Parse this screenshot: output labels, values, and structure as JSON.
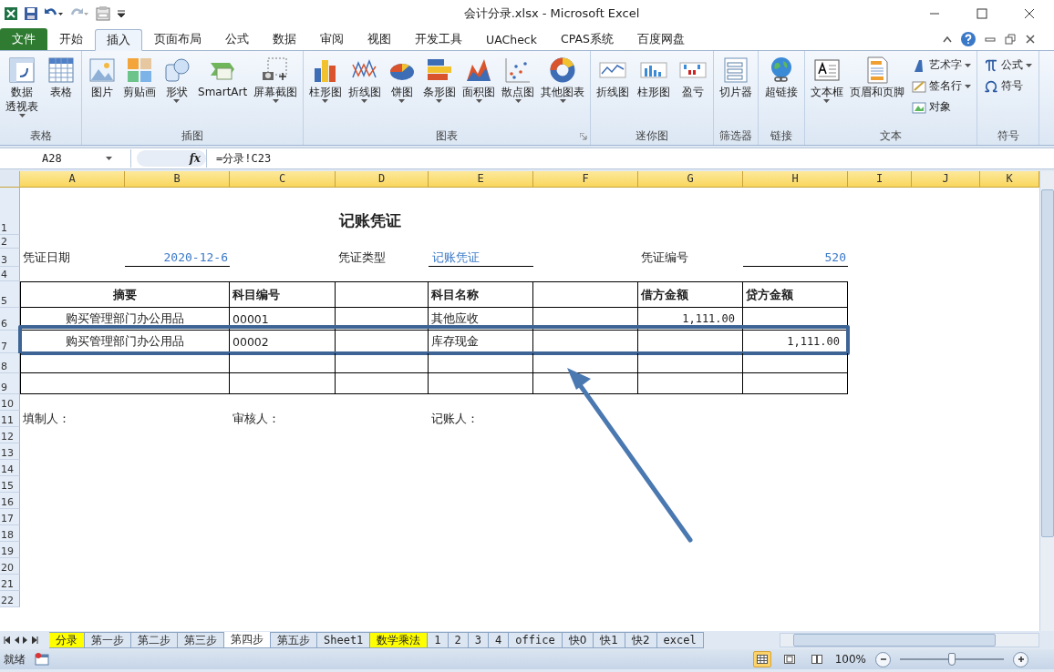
{
  "window": {
    "title": "会计分录.xlsx - Microsoft Excel"
  },
  "ribbon_tabs": [
    {
      "label": "文件",
      "kind": "file",
      "selected": false
    },
    {
      "label": "开始",
      "kind": "tab",
      "selected": false
    },
    {
      "label": "插入",
      "kind": "tab",
      "selected": true
    },
    {
      "label": "页面布局",
      "kind": "tab",
      "selected": false
    },
    {
      "label": "公式",
      "kind": "tab",
      "selected": false
    },
    {
      "label": "数据",
      "kind": "tab",
      "selected": false
    },
    {
      "label": "审阅",
      "kind": "tab",
      "selected": false
    },
    {
      "label": "视图",
      "kind": "tab",
      "selected": false
    },
    {
      "label": "开发工具",
      "kind": "tab",
      "selected": false
    },
    {
      "label": "UACheck",
      "kind": "tab",
      "selected": false
    },
    {
      "label": "CPAS系统",
      "kind": "tab",
      "selected": false
    },
    {
      "label": "百度网盘",
      "kind": "tab",
      "selected": false
    }
  ],
  "ribbon_groups": [
    {
      "label": "表格",
      "launcher": false,
      "items": [
        {
          "label": "数据",
          "sublabel": "透视表",
          "kind": "large",
          "dropdown": true
        },
        {
          "label": "表格",
          "kind": "large",
          "dropdown": false
        }
      ]
    },
    {
      "label": "插图",
      "launcher": false,
      "items": [
        {
          "label": "图片",
          "kind": "large",
          "dropdown": false
        },
        {
          "label": "剪贴画",
          "kind": "large",
          "dropdown": false
        },
        {
          "label": "形状",
          "kind": "large",
          "dropdown": true
        },
        {
          "label": "SmartArt",
          "kind": "large",
          "dropdown": false
        },
        {
          "label": "屏幕截图",
          "kind": "large",
          "dropdown": true
        }
      ]
    },
    {
      "label": "图表",
      "launcher": true,
      "items": [
        {
          "label": "柱形图",
          "kind": "large",
          "dropdown": true
        },
        {
          "label": "折线图",
          "kind": "large",
          "dropdown": true
        },
        {
          "label": "饼图",
          "kind": "large",
          "dropdown": true
        },
        {
          "label": "条形图",
          "kind": "large",
          "dropdown": true
        },
        {
          "label": "面积图",
          "kind": "large",
          "dropdown": true
        },
        {
          "label": "散点图",
          "kind": "large",
          "dropdown": true
        },
        {
          "label": "其他图表",
          "kind": "large",
          "dropdown": true
        }
      ]
    },
    {
      "label": "迷你图",
      "launcher": false,
      "items": [
        {
          "label": "折线图",
          "kind": "large",
          "dropdown": false
        },
        {
          "label": "柱形图",
          "kind": "large",
          "dropdown": false
        },
        {
          "label": "盈亏",
          "kind": "large",
          "dropdown": false
        }
      ]
    },
    {
      "label": "筛选器",
      "launcher": false,
      "items": [
        {
          "label": "切片器",
          "kind": "large",
          "dropdown": false
        }
      ]
    },
    {
      "label": "链接",
      "launcher": false,
      "items": [
        {
          "label": "超链接",
          "kind": "large",
          "dropdown": false
        }
      ]
    },
    {
      "label": "文本",
      "launcher": false,
      "items": [
        {
          "label": "文本框",
          "kind": "large",
          "dropdown": true
        },
        {
          "label": "页眉和页脚",
          "kind": "large",
          "dropdown": false
        },
        {
          "label": "艺术字",
          "kind": "small",
          "dropdown": true
        },
        {
          "label": "签名行",
          "kind": "small",
          "dropdown": true
        },
        {
          "label": "对象",
          "kind": "small",
          "dropdown": false
        }
      ]
    },
    {
      "label": "符号",
      "launcher": false,
      "items": [
        {
          "label": "公式",
          "kind": "small",
          "dropdown": true
        },
        {
          "label": "符号",
          "kind": "small",
          "dropdown": false
        }
      ]
    }
  ],
  "formula_bar": {
    "name_box": "A28",
    "function_label": "fx",
    "formula": "=分录!C23"
  },
  "sheet": {
    "columns": [
      "A",
      "B",
      "C",
      "D",
      "E",
      "F",
      "G",
      "H",
      "I",
      "J",
      "K"
    ],
    "rows": [
      {
        "number": "1",
        "boxed": false,
        "highlighted": false,
        "cells": [
          "",
          "",
          "",
          {
            "text": "记账凭证",
            "kind": "title"
          }
        ]
      },
      {
        "number": "2",
        "boxed": false,
        "highlighted": false,
        "cells": []
      },
      {
        "number": "3",
        "boxed": false,
        "highlighted": false,
        "cells": [
          {
            "text": "凭证日期",
            "kind": "label"
          },
          {
            "text": "2020-12-6",
            "kind": "field-number"
          },
          "",
          {
            "text": "凭证类型",
            "kind": "label"
          },
          {
            "text": "记账凭证",
            "kind": "field-text"
          },
          "",
          {
            "text": "凭证编号",
            "kind": "label"
          },
          {
            "text": "520",
            "kind": "field-number"
          }
        ]
      },
      {
        "number": "4",
        "boxed": false,
        "highlighted": false,
        "cells": []
      },
      {
        "number": "5",
        "boxed": true,
        "highlighted": false,
        "cells": [
          {
            "text": "摘要",
            "kind": "heading-centered",
            "colspan": 2
          },
          {
            "text": "科目编号",
            "kind": "heading"
          },
          "",
          {
            "text": "科目名称",
            "kind": "heading"
          },
          "",
          {
            "text": "借方金额",
            "kind": "heading"
          },
          {
            "text": "贷方金额",
            "kind": "heading"
          }
        ]
      },
      {
        "number": "6",
        "boxed": true,
        "highlighted": false,
        "cells": [
          {
            "text": "购买管理部门办公用品",
            "kind": "text-centered",
            "colspan": 2
          },
          {
            "text": "00001",
            "kind": "text"
          },
          "",
          {
            "text": "其他应收",
            "kind": "text"
          },
          "",
          {
            "text": "1,111.00",
            "kind": "amount"
          }
        ]
      },
      {
        "number": "7",
        "boxed": true,
        "highlighted": true,
        "cells": [
          {
            "text": "购买管理部门办公用品",
            "kind": "text-centered",
            "colspan": 2
          },
          {
            "text": "00002",
            "kind": "text"
          },
          "",
          {
            "text": "库存现金",
            "kind": "text"
          },
          "",
          "",
          {
            "text": "1,111.00",
            "kind": "amount"
          }
        ]
      },
      {
        "number": "8",
        "boxed": true,
        "highlighted": false,
        "cells": [
          {
            "colspan": 2
          }
        ]
      },
      {
        "number": "9",
        "boxed": true,
        "highlighted": false,
        "cells": [
          {
            "colspan": 2
          }
        ]
      },
      {
        "number": "10",
        "boxed": false,
        "highlighted": false,
        "cells": []
      },
      {
        "number": "11",
        "boxed": false,
        "highlighted": false,
        "cells": [
          {
            "text": "填制人：",
            "kind": "label"
          },
          "",
          {
            "text": "审核人：",
            "kind": "label"
          },
          "",
          {
            "text": "记账人：",
            "kind": "label"
          }
        ]
      },
      {
        "number": "12",
        "boxed": false,
        "highlighted": false,
        "cells": []
      },
      {
        "number": "13",
        "boxed": false,
        "highlighted": false,
        "cells": []
      },
      {
        "number": "14",
        "boxed": false,
        "highlighted": false,
        "cells": []
      },
      {
        "number": "15",
        "boxed": false,
        "highlighted": false,
        "cells": []
      },
      {
        "number": "16",
        "boxed": false,
        "highlighted": false,
        "cells": []
      },
      {
        "number": "17",
        "boxed": false,
        "highlighted": false,
        "cells": []
      },
      {
        "number": "18",
        "boxed": false,
        "highlighted": false,
        "cells": []
      },
      {
        "number": "19",
        "boxed": false,
        "highlighted": false,
        "cells": []
      },
      {
        "number": "20",
        "boxed": false,
        "highlighted": false,
        "cells": []
      },
      {
        "number": "21",
        "boxed": false,
        "highlighted": false,
        "cells": []
      },
      {
        "number": "22",
        "boxed": false,
        "highlighted": false,
        "cells": []
      }
    ]
  },
  "sheet_tabs": [
    {
      "label": "分录",
      "selected": false,
      "color": "#ffff00"
    },
    {
      "label": "第一步",
      "selected": false
    },
    {
      "label": "第二步",
      "selected": false
    },
    {
      "label": "第三步",
      "selected": false
    },
    {
      "label": "第四步",
      "selected": true
    },
    {
      "label": "第五步",
      "selected": false
    },
    {
      "label": "Sheet1",
      "selected": false
    },
    {
      "label": "数学乘法",
      "selected": false,
      "color": "#ffff00"
    },
    {
      "label": "1",
      "selected": false
    },
    {
      "label": "2",
      "selected": false
    },
    {
      "label": "3",
      "selected": false
    },
    {
      "label": "4",
      "selected": false
    },
    {
      "label": "office",
      "selected": false
    },
    {
      "label": "快0",
      "selected": false
    },
    {
      "label": "快1",
      "selected": false
    },
    {
      "label": "快2",
      "selected": false
    },
    {
      "label": "excel",
      "selected": false
    }
  ],
  "status_bar": {
    "status": "就绪",
    "view_buttons": [
      {
        "selected": true
      },
      {
        "selected": false
      },
      {
        "selected": false
      }
    ],
    "zoom": "100%",
    "zoom_slider": {
      "level": 0.5
    }
  }
}
